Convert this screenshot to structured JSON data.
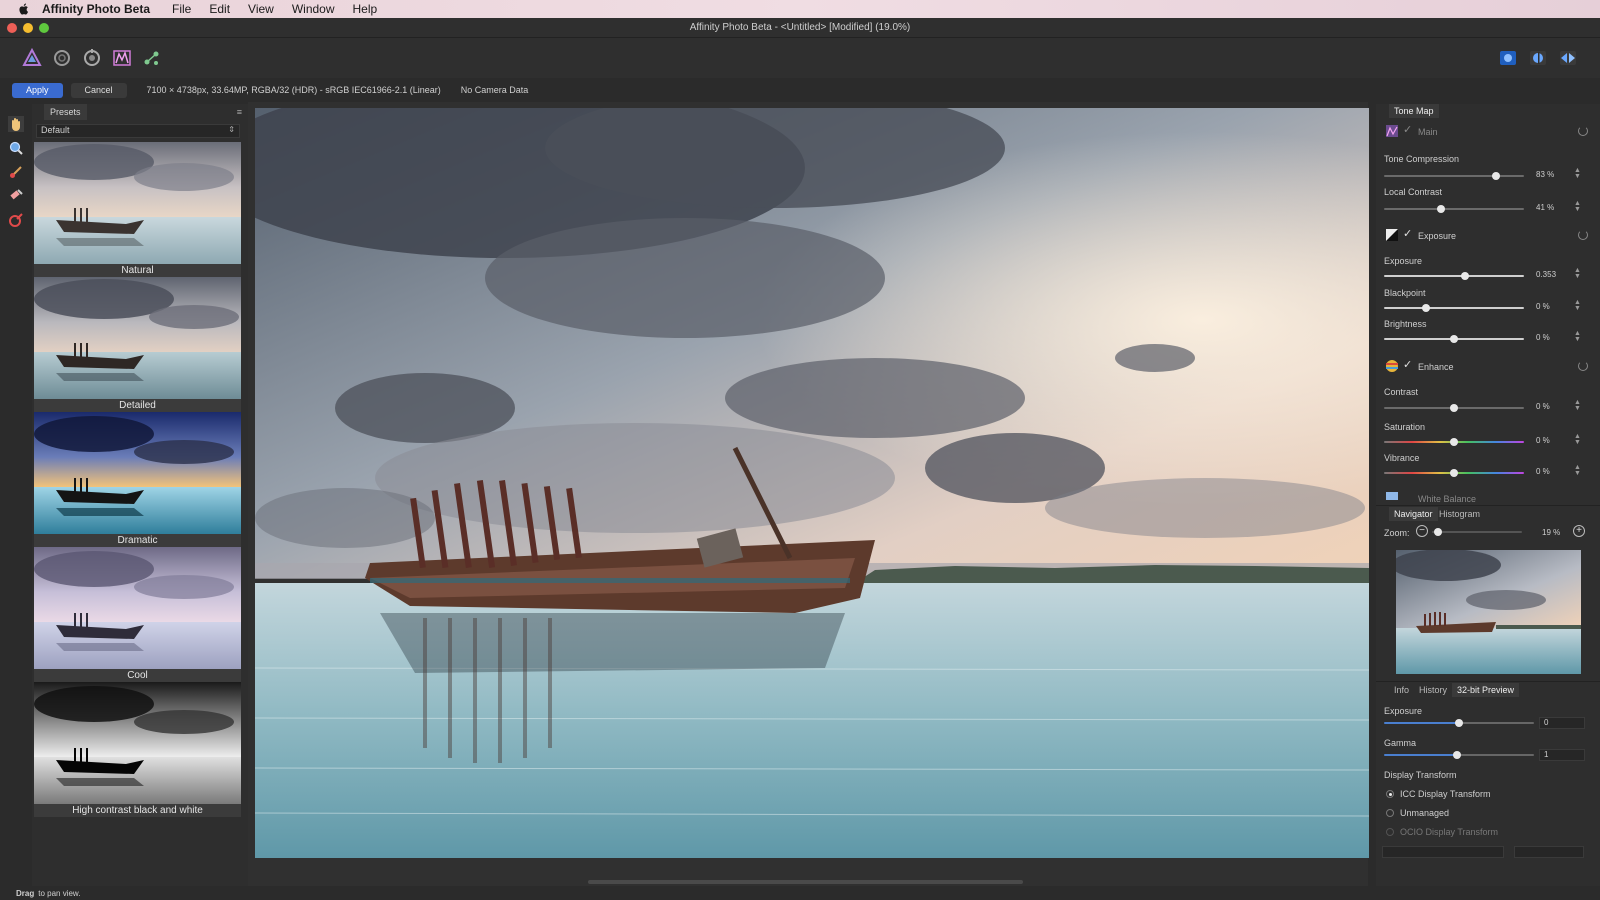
{
  "menubar": {
    "app_name": "Affinity Photo Beta",
    "items": [
      "File",
      "Edit",
      "View",
      "Window",
      "Help"
    ]
  },
  "window": {
    "title": "Affinity Photo Beta - <Untitled> [Modified] (19.0%)"
  },
  "toolbar": {
    "persona_icons": [
      "photo-persona-icon",
      "liquify-persona-icon",
      "develop-persona-icon",
      "tone-mapping-persona-icon",
      "export-persona-icon"
    ],
    "view_icons": [
      "view-mode-icon",
      "split-view-icon",
      "mirror-view-icon"
    ]
  },
  "context": {
    "apply_label": "Apply",
    "cancel_label": "Cancel",
    "doc_info": "7100 × 4738px, 33.64MP, RGBA/32 (HDR) - sRGB IEC61966-2.1 (Linear)",
    "camera_info": "No Camera Data"
  },
  "tools": [
    "hand-tool-icon",
    "zoom-tool-icon",
    "paint-brush-tool-icon",
    "erase-brush-tool-icon",
    "color-picker-tool-icon"
  ],
  "presets": {
    "tab_label": "Presets",
    "selected_category": "Default",
    "items": [
      {
        "label": "Natural"
      },
      {
        "label": "Detailed"
      },
      {
        "label": "Dramatic"
      },
      {
        "label": "Cool"
      },
      {
        "label": "High contrast black and white"
      }
    ]
  },
  "tonemap": {
    "tab_label": "Tone Map",
    "main": {
      "label": "Main"
    },
    "tone_compression": {
      "label": "Tone Compression",
      "value": "83 %",
      "level": 0.8
    },
    "local_contrast": {
      "label": "Local Contrast",
      "value": "41 %",
      "level": 0.41
    },
    "exposure_section": {
      "label": "Exposure"
    },
    "exposure": {
      "label": "Exposure",
      "value": "0.353",
      "level": 0.58
    },
    "blackpoint": {
      "label": "Blackpoint",
      "value": "0 %",
      "level": 0.3
    },
    "brightness": {
      "label": "Brightness",
      "value": "0 %",
      "level": 0.5
    },
    "enhance_section": {
      "label": "Enhance"
    },
    "contrast": {
      "label": "Contrast",
      "value": "0 %",
      "level": 0.5
    },
    "saturation": {
      "label": "Saturation",
      "value": "0 %",
      "level": 0.5
    },
    "vibrance": {
      "label": "Vibrance",
      "value": "0 %",
      "level": 0.5
    },
    "white_balance_section": {
      "label": "White Balance"
    }
  },
  "navigator": {
    "tabs": [
      "Navigator",
      "Histogram"
    ],
    "zoom_label": "Zoom:",
    "zoom_value": "19 %"
  },
  "preview32": {
    "tabs": [
      "Info",
      "History",
      "32-bit Preview"
    ],
    "exposure": {
      "label": "Exposure",
      "value": "0"
    },
    "gamma": {
      "label": "Gamma",
      "value": "1"
    },
    "display_transform_label": "Display Transform",
    "options": [
      {
        "label": "ICC Display Transform",
        "selected": true
      },
      {
        "label": "Unmanaged",
        "selected": false
      },
      {
        "label": "OCIO Display Transform",
        "selected": false,
        "disabled": true
      }
    ]
  },
  "status": {
    "bold": "Drag",
    "text": "to pan view."
  },
  "colors": {
    "accent": "#3a6bd0",
    "panel": "#2e2e2e",
    "background": "#2b2b2b"
  }
}
